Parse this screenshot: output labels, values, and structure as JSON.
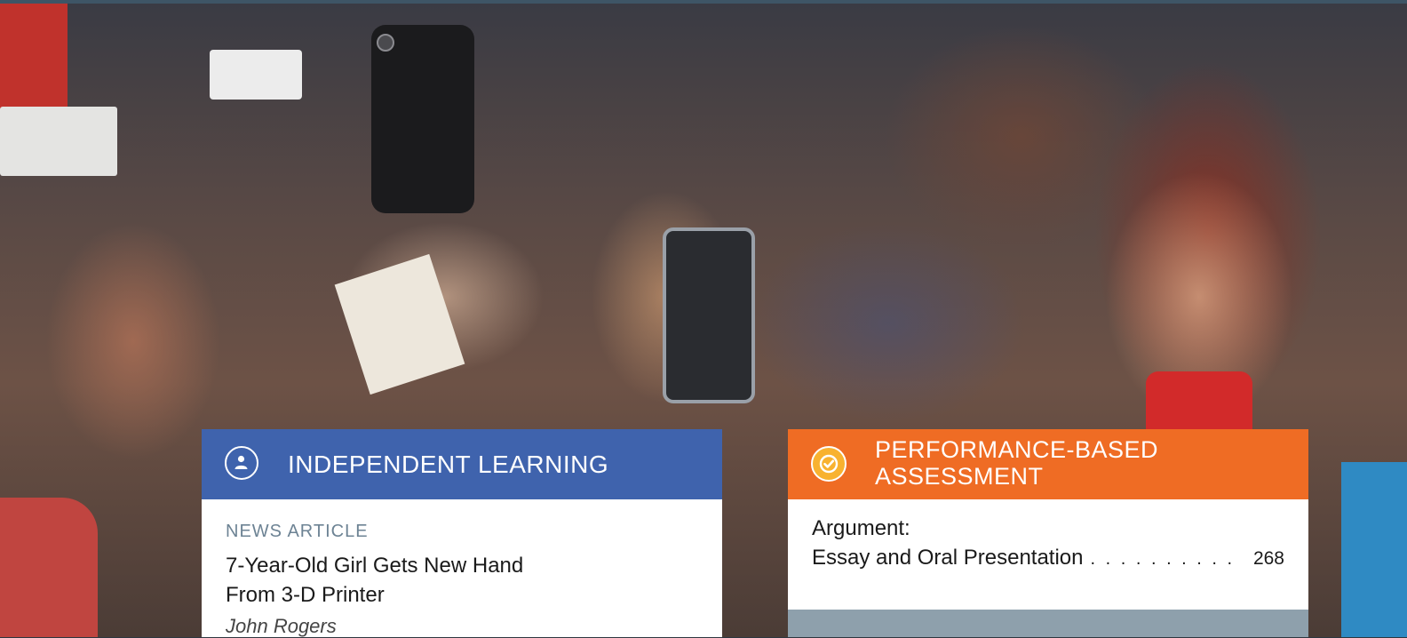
{
  "colors": {
    "independent_header": "#3f63ad",
    "assessment_header": "#ef6c24",
    "check_icon": "#f8b230",
    "kicker_text": "#6d8394",
    "footer_band": "#8ea0ac"
  },
  "independent_learning": {
    "icon": "person-icon",
    "heading": "INDEPENDENT LEARNING",
    "genre": "NEWS ARTICLE",
    "title_line1": "7-Year-Old Girl Gets New Hand",
    "title_line2": "From 3-D Printer",
    "author": "John Rogers"
  },
  "performance_assessment": {
    "icon": "checkmark-icon",
    "heading_line1": "PERFORMANCE-BASED",
    "heading_line2": "ASSESSMENT",
    "item_line1": "Argument:",
    "item_line2": "Essay and Oral Presentation",
    "leader_dots": ". . . . . . . . . .",
    "page": "268"
  }
}
